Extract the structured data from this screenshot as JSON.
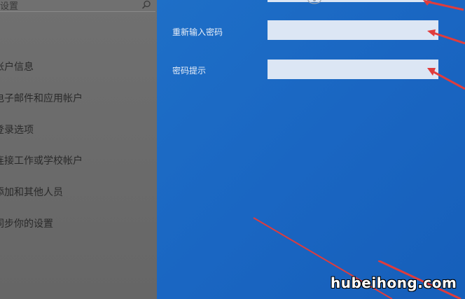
{
  "sidebar": {
    "search_text": "设置",
    "items": [
      {
        "label": "帐户信息"
      },
      {
        "label": "电子邮件和应用帐户"
      },
      {
        "label": "登录选项"
      },
      {
        "label": "连接工作或学校帐户"
      },
      {
        "label": "添加和其他人员"
      },
      {
        "label": "同步你的设置"
      }
    ]
  },
  "form": {
    "fields": [
      {
        "label": "重新输入密码",
        "value": ""
      },
      {
        "label": "密码提示",
        "value": ""
      }
    ]
  },
  "icons": {
    "search": "search-icon",
    "reveal": "eye-icon"
  },
  "colors": {
    "sidebar_bg": "#6b6b6b",
    "main_bg": "#1a66c2",
    "input_bg": "#dce6f4",
    "arrow": "#e03c3c"
  },
  "watermark": "hubeihong.com"
}
